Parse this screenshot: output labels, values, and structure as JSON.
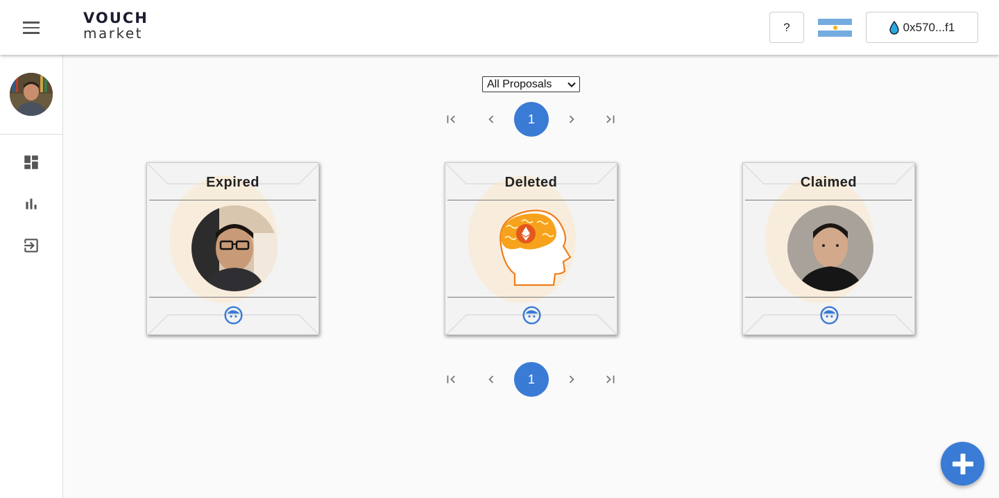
{
  "header": {
    "logo_top": "VOUCH",
    "logo_bottom": "market",
    "help_label": "?",
    "wallet_label": "0x570...f1",
    "flag": "argentina-flag-icon"
  },
  "sidebar": {
    "items": [
      {
        "icon": "dashboard-icon"
      },
      {
        "icon": "bar-chart-icon"
      },
      {
        "icon": "logout-icon"
      }
    ]
  },
  "filter": {
    "selected": "All Proposals"
  },
  "pagination": {
    "current_page": "1"
  },
  "cards": [
    {
      "status": "Expired",
      "image": "person-photo"
    },
    {
      "status": "Deleted",
      "image": "ethereum-brain-icon"
    },
    {
      "status": "Claimed",
      "image": "person-photo"
    }
  ],
  "colors": {
    "accent": "#3a7bd5",
    "brain_orange": "#f7931a",
    "flag_blue": "#74acdf"
  }
}
